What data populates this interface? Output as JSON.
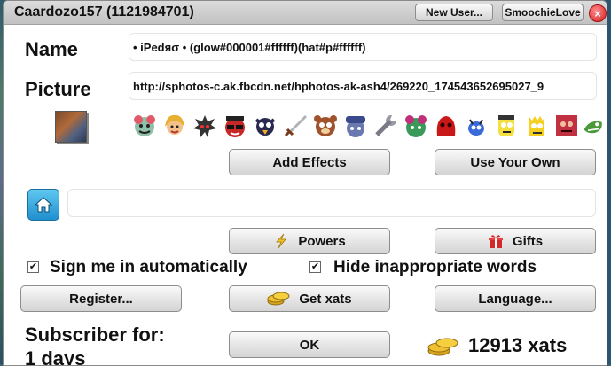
{
  "window": {
    "title": "Caardozo157 (1121984701)",
    "new_user_label": "New User...",
    "smoochie_label": "SmoochieLove",
    "close_glyph": "×"
  },
  "form": {
    "name_label": "Name",
    "name_value": "• iPedяσ •              (glow#000001#ffffff)(hat#p#ffffff)",
    "picture_label": "Picture",
    "picture_value": "http://sphotos-c.ak.fbcdn.net/hphotos-ak-ash4/269220_174543652695027_9",
    "home_value": ""
  },
  "smilies": [
    "plant-smiley",
    "blonde-smiley",
    "spiky-smiley",
    "sunglasses-smiley",
    "dark-bird-smiley",
    "sword-smiley",
    "bear-smiley",
    "cop-smiley",
    "wrench-smiley",
    "bush-smiley",
    "red-blob-smiley",
    "blue-bug-smiley",
    "yellow-man-smiley",
    "bart-smiley",
    "red-face-smiley",
    "lizard-smiley"
  ],
  "buttons": {
    "add_effects": "Add Effects",
    "use_your_own": "Use Your Own",
    "powers": "Powers",
    "gifts": "Gifts",
    "register": "Register...",
    "get_xats": "Get xats",
    "language": "Language...",
    "ok": "OK"
  },
  "options": {
    "sign_in_auto": "Sign me in automatically",
    "sign_in_checked": true,
    "hide_words": "Hide inappropriate words",
    "hide_checked": true
  },
  "status": {
    "subscriber_label": "Subscriber for:",
    "subscriber_days": "1 days",
    "xats_balance": "12913 xats"
  },
  "icons": {
    "lightning": "lightning-icon",
    "gift": "gift-icon",
    "coins": "coins-icon",
    "home": "home-icon"
  }
}
